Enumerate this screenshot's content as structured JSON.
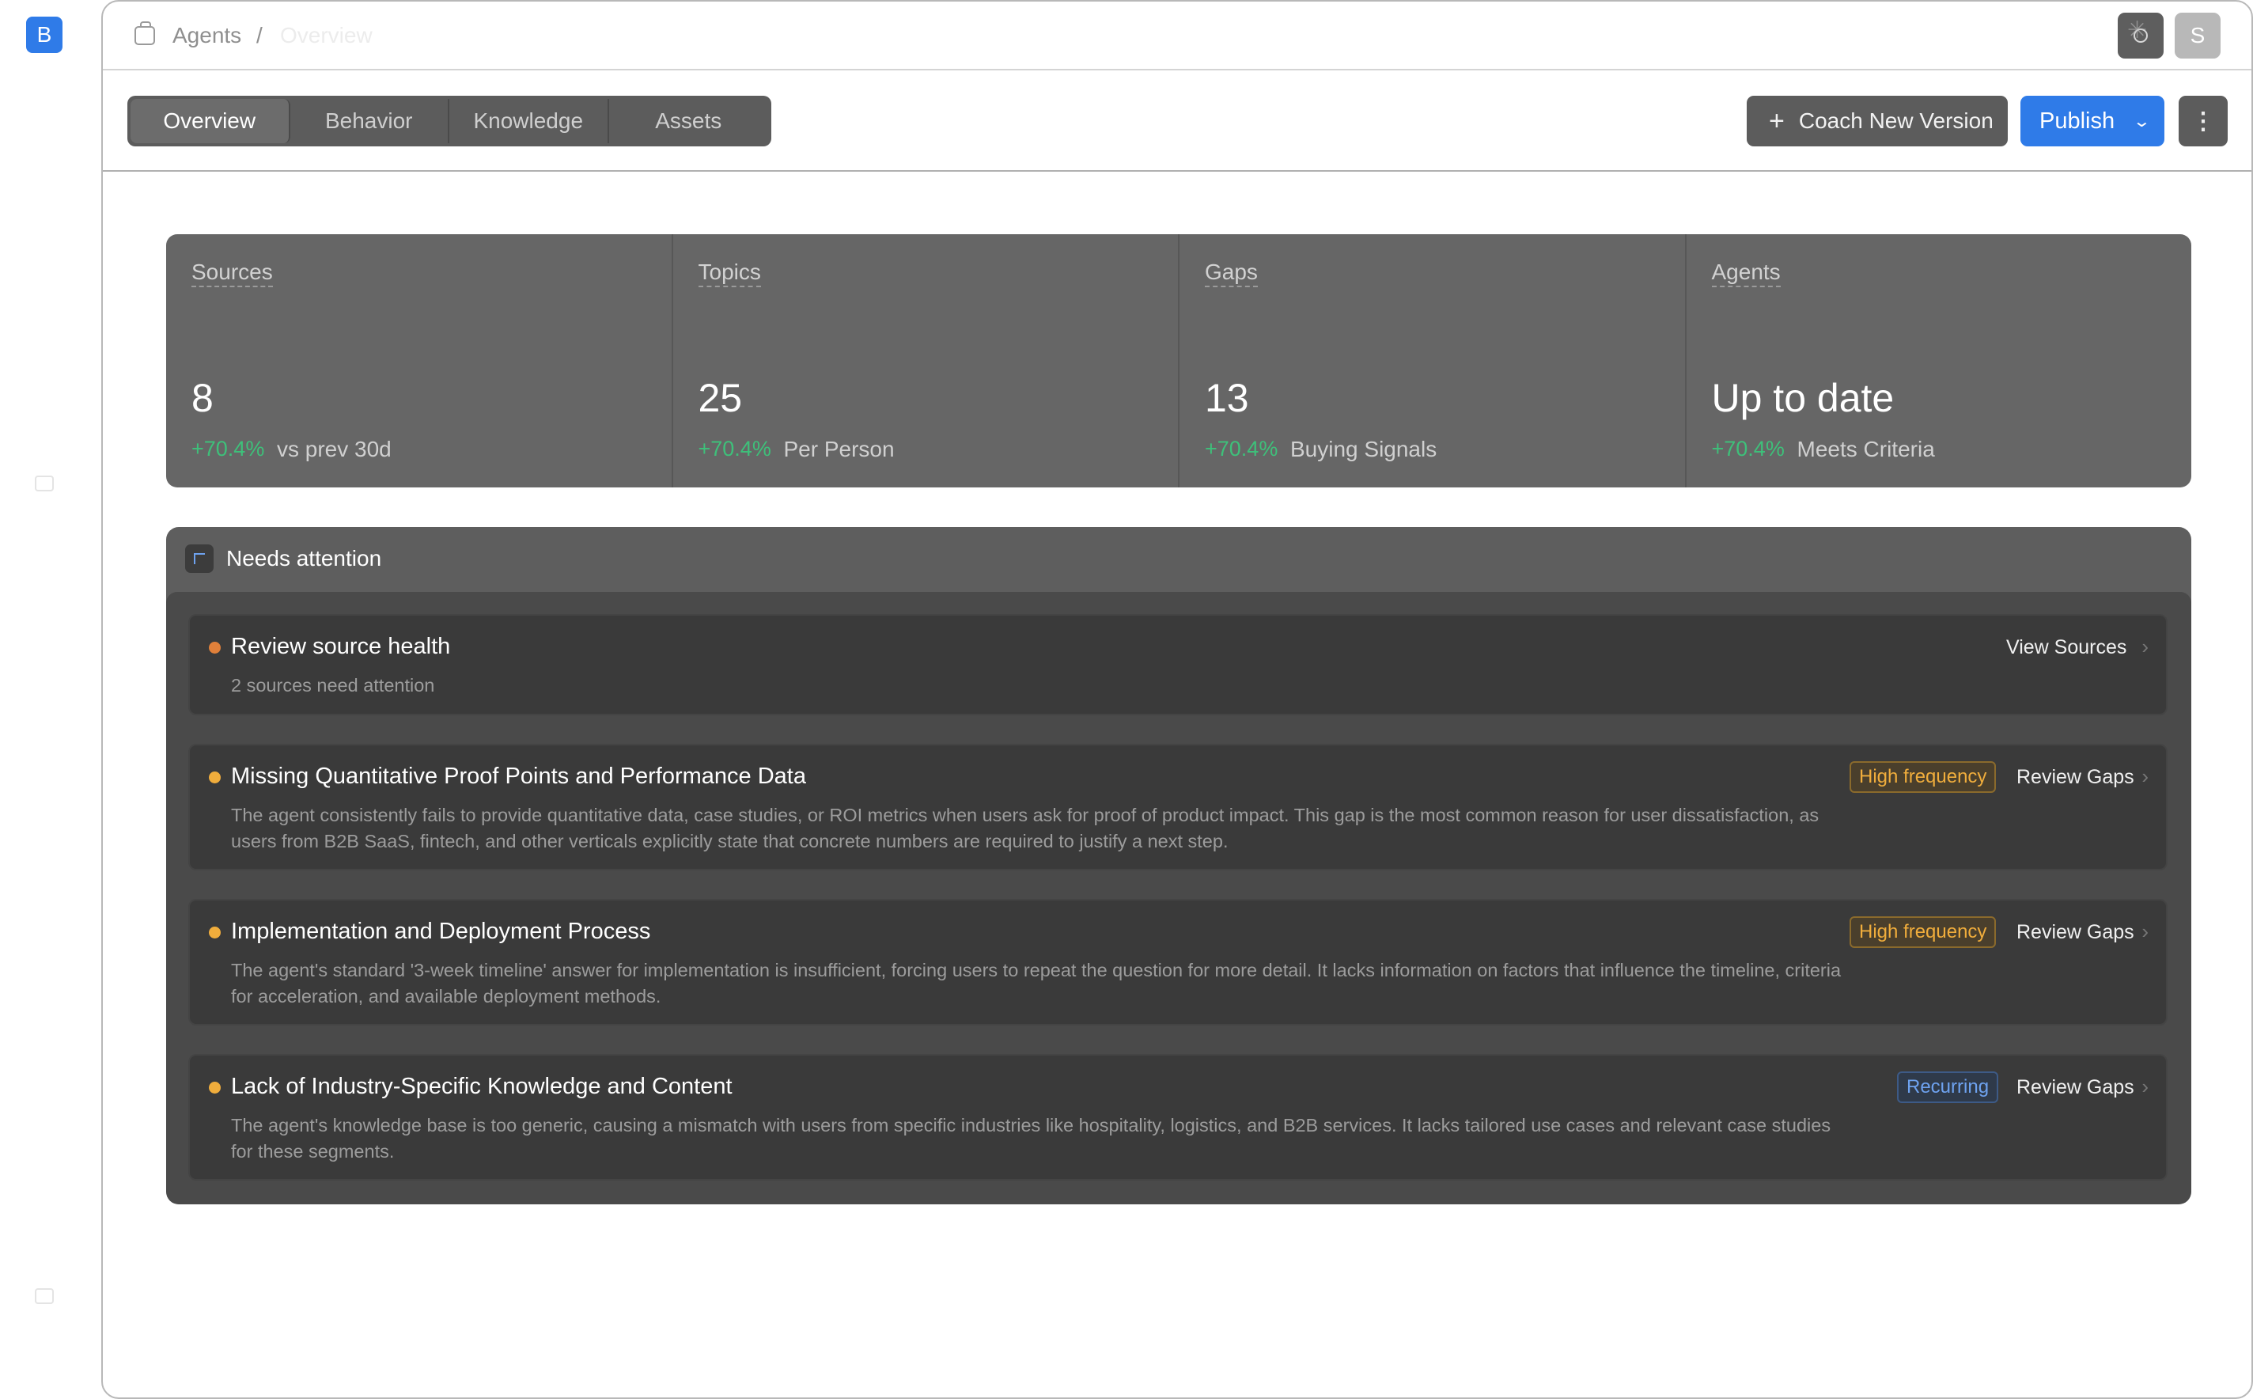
{
  "brand": {
    "letter": "B",
    "color": "#2f7be8"
  },
  "breadcrumb": {
    "parent": "Agents",
    "separator": "/",
    "current": "Overview"
  },
  "header": {
    "avatar_letter": "S",
    "theme_icon": "sun-icon"
  },
  "tabs": [
    {
      "label": "Overview",
      "active": true
    },
    {
      "label": "Behavior",
      "active": false
    },
    {
      "label": "Knowledge",
      "active": false
    },
    {
      "label": "Assets",
      "active": false
    }
  ],
  "actions": {
    "coach_label": "Coach New Version",
    "publish_label": "Publish",
    "more_icon": "more-vertical-icon"
  },
  "stats": [
    {
      "label": "Sources",
      "value": "8",
      "delta": "+70.4%",
      "note": "vs prev 30d"
    },
    {
      "label": "Topics",
      "value": "25",
      "delta": "+70.4%",
      "note": "Per Person"
    },
    {
      "label": "Gaps",
      "value": "13",
      "delta": "+70.4%",
      "note": "Buying Signals"
    },
    {
      "label": "Agents",
      "value": "Up to date",
      "delta": "+70.4%",
      "note": "Meets Criteria"
    }
  ],
  "attention": {
    "title": "Needs attention",
    "items": [
      {
        "title": "Review source health",
        "description": "2 sources need attention",
        "badge": "",
        "action": "View Sources",
        "dot_color": "#e0803a"
      },
      {
        "title": "Missing Quantitative Proof Points and Performance Data",
        "description": "The agent consistently fails to provide quantitative data, case studies, or ROI metrics when users ask for proof of product impact. This gap is the most common reason for user dissatisfaction, as users from B2B SaaS, fintech, and other verticals explicitly state that concrete numbers are required to justify a next step.",
        "badge": "High frequency",
        "action": "Review Gaps",
        "dot_color": "#f0ad3c"
      },
      {
        "title": "Implementation and Deployment Process",
        "description": "The agent's standard '3-week timeline' answer for implementation is insufficient, forcing users to repeat the question for more detail. It lacks information on factors that influence the timeline, criteria for acceleration, and available deployment methods.",
        "badge": "High frequency",
        "action": "Review Gaps",
        "dot_color": "#f0ad3c"
      },
      {
        "title": "Lack of Industry-Specific Knowledge and Content",
        "description": "The agent's knowledge base is too generic, causing a mismatch with users from specific industries like hospitality, logistics, and B2B services. It lacks tailored use cases and relevant case studies for these segments.",
        "badge": "Recurring",
        "action": "Review Gaps",
        "dot_color": "#f0ad3c"
      }
    ]
  },
  "colors": {
    "accent": "#2f7be8",
    "positive": "#3ec07a",
    "warning": "#f0ad3c",
    "info": "#6ea2ef"
  }
}
